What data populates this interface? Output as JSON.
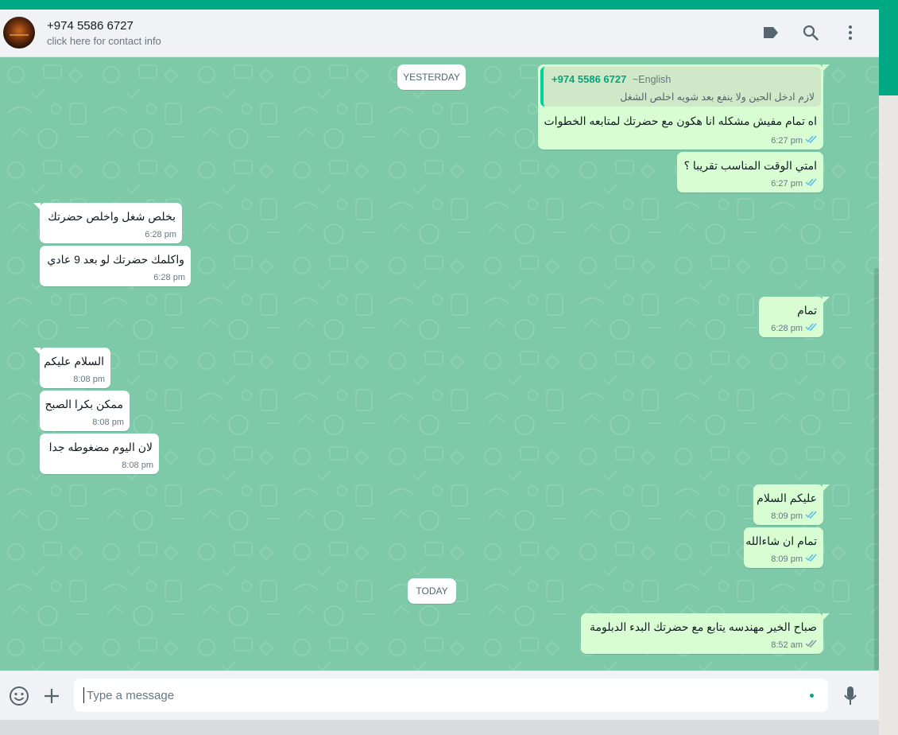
{
  "colors": {
    "accent": "#00a884",
    "outgoing_bubble": "#d9fdd3",
    "incoming_bubble": "#ffffff",
    "chat_background": "#7dc9a8",
    "tick_read": "#53bdeb"
  },
  "header": {
    "contact_name": "+974 5586 6727",
    "contact_subtitle": "click here for contact info",
    "icons": [
      "label-icon",
      "search-icon",
      "menu-icon"
    ]
  },
  "chat": {
    "date_yesterday": "YESTERDAY",
    "date_today": "TODAY",
    "messages": [
      {
        "dir": "out",
        "quoted_name": "+974 5586 6727",
        "quoted_pushname": "~English",
        "quoted_text": "لازم ادخل الحين ولا ينفع بعد شويه اخلص الشغل",
        "text": "اه تمام مفيش مشكله انا هكون مع حضرتك لمتابعه الخطوات",
        "time": "6:27 pm",
        "status": "read"
      },
      {
        "dir": "out",
        "text": "امتي الوقت المناسب تقريبا ؟",
        "time": "6:27 pm",
        "status": "read"
      },
      {
        "dir": "in",
        "text": "بخلص شغل واخلص حضرتك",
        "time": "6:28 pm"
      },
      {
        "dir": "in",
        "text": "واكلمك حضرتك لو بعد 9 عادي",
        "time": "6:28 pm"
      },
      {
        "dir": "out",
        "text": "تمام",
        "time": "6:28 pm",
        "status": "read"
      },
      {
        "dir": "in",
        "text": "السلام عليكم",
        "time": "8:08 pm"
      },
      {
        "dir": "in",
        "text": "ممكن بكرا الصبح",
        "time": "8:08 pm"
      },
      {
        "dir": "in",
        "text": "لان اليوم مضغوطه جدا",
        "time": "8:08 pm"
      },
      {
        "dir": "out",
        "text": "عليكم السلام",
        "time": "8:09 pm",
        "status": "read"
      },
      {
        "dir": "out",
        "text": "تمام ان شاءالله",
        "time": "8:09 pm",
        "status": "read"
      },
      {
        "dir": "out",
        "text": "صباح الخير مهندسه يتابع مع حضرتك البدء الدبلومة",
        "time": "8:52 am",
        "status": "delivered"
      }
    ]
  },
  "footer": {
    "input_placeholder": "Type a message",
    "input_value": "",
    "icons": [
      "emoji-icon",
      "attach-plus-icon",
      "microphone-icon"
    ]
  }
}
